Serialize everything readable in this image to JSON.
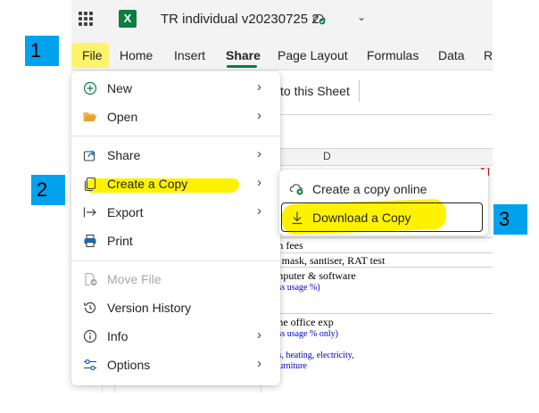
{
  "titlebar": {
    "app_icon": "excel-icon",
    "app_letter": "X",
    "title": "TR individual v20230725 2",
    "sync_icon": "cloud-sync-icon",
    "title_chevron": "chevron-down-icon"
  },
  "ribbon": {
    "tabs": [
      {
        "label": "File"
      },
      {
        "label": "Home"
      },
      {
        "label": "Insert"
      },
      {
        "label": "Share"
      },
      {
        "label": "Page Layout"
      },
      {
        "label": "Formulas"
      },
      {
        "label": "Data"
      },
      {
        "label": "R"
      }
    ],
    "active_tab": "Share"
  },
  "toolbar": {
    "partial_command": "to this Sheet"
  },
  "sheet": {
    "column_header": "D",
    "red_char": "U",
    "cells": [
      "ion fees",
      "ce mask, santiser, RAT test",
      "omputer & software",
      "ome office exp"
    ],
    "blue_cells": [
      "ness usage %)",
      "ness usage % only)",
      "gas, heating, electricity,",
      "e furniture"
    ]
  },
  "file_menu": {
    "items": [
      {
        "label": "New",
        "icon": "plus-circle-icon",
        "chevron": true
      },
      {
        "label": "Open",
        "icon": "folder-open-icon",
        "chevron": true
      },
      {
        "label": "Share",
        "icon": "share-icon",
        "chevron": true
      },
      {
        "label": "Create a Copy",
        "icon": "copy-icon",
        "chevron": true
      },
      {
        "label": "Export",
        "icon": "export-icon",
        "chevron": true
      },
      {
        "label": "Print",
        "icon": "printer-icon",
        "chevron": false
      },
      {
        "label": "Move File",
        "icon": "move-file-icon",
        "chevron": false,
        "disabled": true
      },
      {
        "label": "Version History",
        "icon": "history-icon",
        "chevron": false
      },
      {
        "label": "Info",
        "icon": "info-icon",
        "chevron": true
      },
      {
        "label": "Options",
        "icon": "options-icon",
        "chevron": true
      }
    ]
  },
  "copy_submenu": {
    "items": [
      {
        "label": "Create a copy online",
        "icon": "cloud-add-icon"
      },
      {
        "label": "Download a Copy",
        "icon": "download-icon"
      }
    ]
  },
  "annotations": {
    "step1": "1",
    "step2": "2",
    "step3": "3",
    "highlight_color": "#fff200",
    "badge_color": "#00a2ed"
  },
  "colors": {
    "excel_green": "#107c41",
    "chrome_bg": "#f3f3f3"
  }
}
